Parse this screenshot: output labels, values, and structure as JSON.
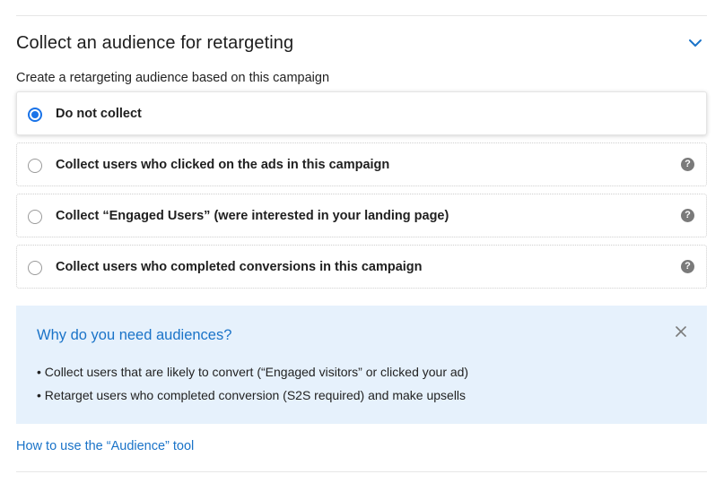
{
  "section": {
    "title": "Collect an audience for retargeting",
    "subtitle": "Create a retargeting audience based on this campaign"
  },
  "options": [
    {
      "label": "Do not collect",
      "selected": true,
      "has_help": false
    },
    {
      "label": "Collect users who clicked on the ads in this campaign",
      "selected": false,
      "has_help": true
    },
    {
      "label": "Collect “Engaged Users” (were interested in your landing page)",
      "selected": false,
      "has_help": true
    },
    {
      "label": "Collect users who completed conversions in this campaign",
      "selected": false,
      "has_help": true
    }
  ],
  "help_glyph": "?",
  "info": {
    "title": "Why do you need audiences?",
    "items": [
      "Collect users that are likely to convert (“Engaged visitors” or clicked your ad)",
      "Retarget users who completed conversion (S2S required) and make upsells"
    ]
  },
  "link": {
    "label": "How to use the “Audience” tool"
  },
  "colors": {
    "accent": "#1a73e8",
    "link": "#1a73c8",
    "info_bg": "#e6f1fc",
    "help_icon": "#7a7a7a"
  },
  "icons": {
    "collapse": "chevron-down-icon",
    "close": "close-icon",
    "help": "question-circle-icon"
  }
}
